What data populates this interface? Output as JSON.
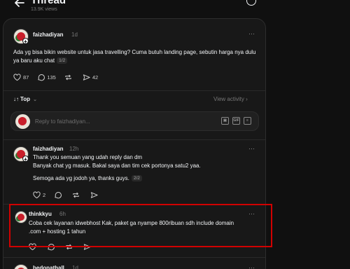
{
  "header": {
    "title": "Thread",
    "views": "13.9K views"
  },
  "op": {
    "username": "faizhadiyan",
    "time": "1d",
    "text": "Ada yg bisa bikin website untuk jasa travelling? Cuma butuh landing page, sebutin harga nya dulu ya baru aku chat",
    "pager": "1/2",
    "likes": "87",
    "comments": "135",
    "shares": "42"
  },
  "sort": {
    "label": "Top",
    "view_activity": "View activity"
  },
  "reply_box": {
    "placeholder": "Reply to faizhadiyan..."
  },
  "replies": [
    {
      "username": "faizhadiyan",
      "time": "12h",
      "lines": [
        "Thank you semuan yang udah reply dan dm",
        "Banyak chat yg masuk. Bakal saya dan tim cek portonya satu2 yaa.",
        "Semoga ada yg jodoh ya, thanks guys."
      ],
      "pager": "2/2",
      "likes": "2"
    },
    {
      "username": "thinkkyu",
      "time": "6h",
      "line1": "Coba cek layanan idwebhost Kak, paket ga nyampe 800ribuan sdh include domain",
      "line2": ".com + hosting 1 tahun"
    },
    {
      "username": "bedonathall",
      "time": "1d"
    }
  ],
  "colors": {
    "background": "#101010",
    "card": "#181818",
    "highlight": "#d10000"
  }
}
